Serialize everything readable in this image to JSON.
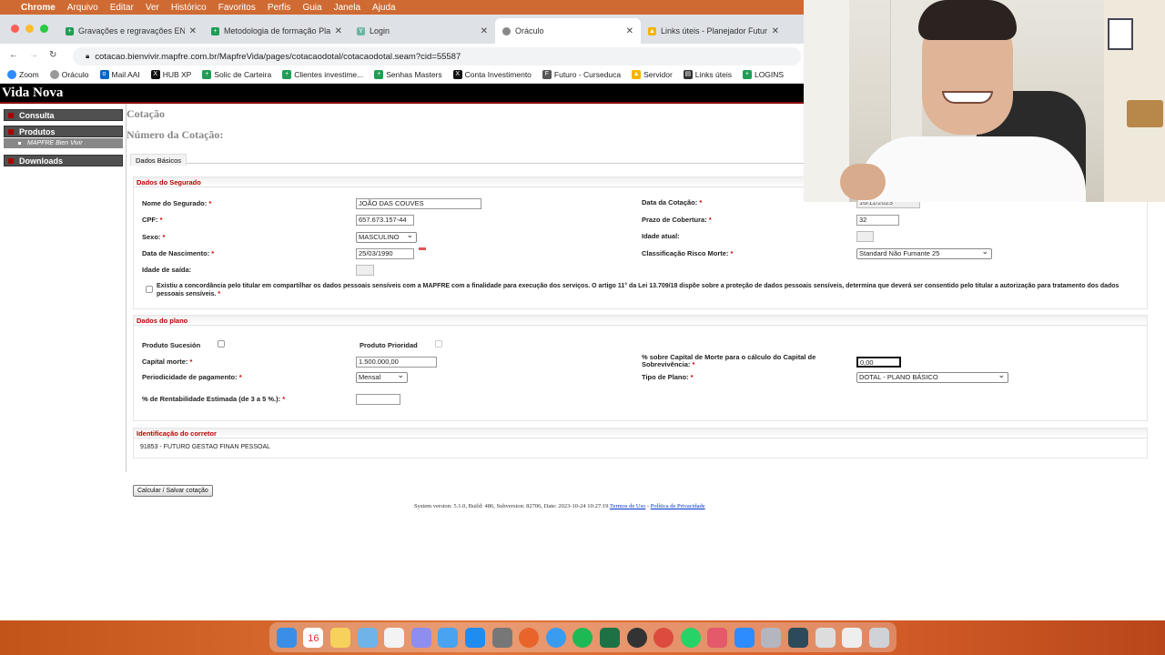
{
  "menubar": {
    "app": "Chrome",
    "items": [
      "Arquivo",
      "Editar",
      "Ver",
      "Histórico",
      "Favoritos",
      "Perfis",
      "Guia",
      "Janela",
      "Ajuda"
    ]
  },
  "tabs": [
    {
      "label": "Gravações e regravações ENF",
      "icon": "sheets-icon",
      "active": false
    },
    {
      "label": "Metodologia de formação Pla",
      "icon": "sheets-icon",
      "active": false
    },
    {
      "label": "Login",
      "icon": "y-icon",
      "active": false
    },
    {
      "label": "Oráculo",
      "icon": "globe-icon",
      "active": true
    },
    {
      "label": "Links úteis - Planejador Futur",
      "icon": "drive-icon",
      "active": false
    }
  ],
  "address": {
    "url": "cotacao.bienvivir.mapfre.com.br/MapfreVida/pages/cotacaodotal/cotacaodotal.seam?cid=55587"
  },
  "bookmarks": [
    "Zoom",
    "Oráculo",
    "Mail AAI",
    "HUB XP",
    "Solic de Carteira",
    "Clientes investime...",
    "Senhas Masters",
    "Conta Investimento",
    "Futuro - Curseduca",
    "Servidor",
    "Links úteis",
    "LOGINS"
  ],
  "site": {
    "header": "Vida Nova"
  },
  "sidebar": {
    "items": [
      "Consulta",
      "Produtos",
      "Downloads"
    ],
    "sub": "MAPFRE Bien Vivir"
  },
  "page": {
    "title": "Cotação",
    "subtitle": "Número da Cotação:",
    "tab": "Dados Básicos"
  },
  "segurado": {
    "header": "Dados do Segurado",
    "nome_label": "Nome do Segurado:",
    "nome": "JOÃO DAS COUVES",
    "cpf_label": "CPF:",
    "cpf": "657.673.157-44",
    "sexo_label": "Sexo:",
    "sexo": "MASCULINO",
    "nasc_label": "Data de Nascimento:",
    "nasc": "25/03/1990",
    "saida_label": "Idade de saída:",
    "data_cot_label": "Data da Cotação:",
    "data_cot": "16/11/2023",
    "prazo_label": "Prazo de Cobertura:",
    "prazo": "32",
    "idade_label": "Idade atual:",
    "risco_label": "Classificação Risco Morte:",
    "risco": "Standard Não Fumante 25",
    "consent": "Existiu a concordância pelo titular em compartilhar os dados pessoais sensíveis com a MAPFRE com a finalidade para execução dos serviços. O artigo 11° da Lei 13.709/18 dispõe sobre a proteção de dados pessoais sensíveis, determina que deverá ser consentido pelo titular a autorização para tratamento dos dados pessoais sensíveis."
  },
  "plano": {
    "header": "Dados do plano",
    "sucesion_label": "Produto Sucesión",
    "prioridad_label": "Produto Prioridad",
    "capital_label": "Capital morte:",
    "capital": "1.500.000,00",
    "periodicidade_label": "Periodicidade de pagamento:",
    "periodicidade": "Mensal",
    "rentab_label": "% de Rentabilidade Estimada (de 3 a 5 %.):",
    "pct_label": "% sobre Capital de Morte para o cálculo do Capital de Sobrevivência:",
    "pct": "0,00",
    "tipo_label": "Tipo de Plano:",
    "tipo": "DOTAL - PLANO BÁSICO"
  },
  "corretor": {
    "header": "Identificação do corretor",
    "value": "91853 - FUTURO GESTAO FINAN PESSOAL"
  },
  "actions": {
    "calc": "Calcular / Salvar cotação"
  },
  "footer": {
    "text": "System version: 5.1.0, Build: 486, Subversion: 82706, Date: 2023-10-24 10:27:19.",
    "terms": "Termos de Uso",
    "sep": " - ",
    "privacy": "Política de Privacidade"
  },
  "dock": {
    "calendar_day": "16"
  }
}
